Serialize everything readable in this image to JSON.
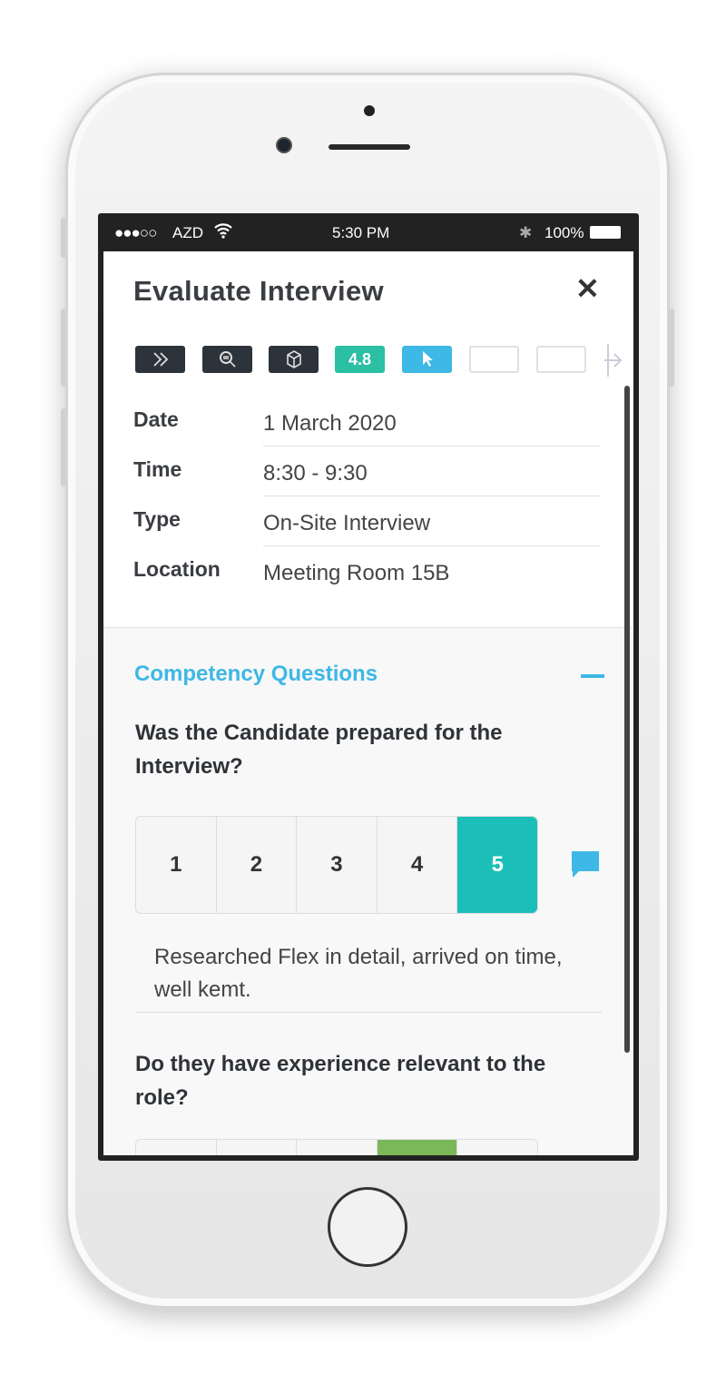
{
  "status_bar": {
    "signal": "●●●○○",
    "carrier": "AZD",
    "time": "5:30 PM",
    "battery": "100%"
  },
  "header": {
    "title": "Evaluate Interview",
    "close_icon": "close-icon"
  },
  "toolbar": {
    "rating_badge": "4.8",
    "icons": [
      "chevrons-right-icon",
      "zoom-icon",
      "cube-icon",
      "rating-badge",
      "cursor-icon",
      "empty",
      "empty",
      "arrow-right-icon"
    ],
    "colors": {
      "dark": "#2d333b",
      "rating": "#2bbfa4",
      "cursor": "#3eb8e5"
    }
  },
  "details": [
    {
      "label": "Date",
      "value": "1 March 2020"
    },
    {
      "label": "Time",
      "value": "8:30 - 9:30"
    },
    {
      "label": "Type",
      "value": "On-Site Interview"
    },
    {
      "label": "Location",
      "value": "Meeting Room 15B"
    }
  ],
  "competency": {
    "title": "Competency Questions",
    "accent": "#3eb8e5",
    "questions": [
      {
        "text": "Was the Candidate prepared for the Interview?",
        "options": [
          "1",
          "2",
          "3",
          "4",
          "5"
        ],
        "selected": 5,
        "comment": "Researched Flex in detail, arrived on time, well kemt."
      },
      {
        "text": "Do they have experience relevant to the role?",
        "selected": 4
      }
    ]
  }
}
